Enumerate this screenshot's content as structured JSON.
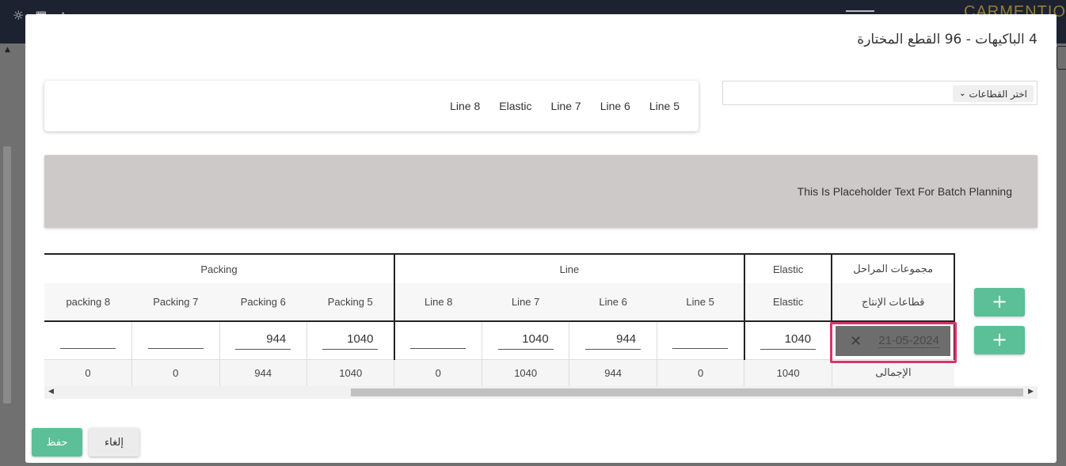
{
  "background": {
    "logo_text": "CARMENTIO"
  },
  "modal": {
    "title": "4 الباكيهات - 96 القطع المختارة",
    "sector_select": {
      "label": "اختر القطاعات"
    },
    "chips": [
      "Line 5",
      "Line 6",
      "Line 7",
      "Elastic",
      "Line 8"
    ],
    "banner_text": "This Is Placeholder Text For Batch Planning",
    "grid": {
      "row_header_group": "مجموعات المراحل",
      "row_header_stage": "قطاعات الإنتاج",
      "total_label": "الإجمالى",
      "groups": [
        {
          "name": "Elastic",
          "stages": [
            "Elastic"
          ]
        },
        {
          "name": "Line",
          "stages": [
            "Line 5",
            "Line 6",
            "Line 7",
            "Line 8"
          ]
        },
        {
          "name": "Packing",
          "stages": [
            "Packing 5",
            "Packing 6",
            "Packing 7",
            "packing 8"
          ]
        }
      ],
      "input_row": {
        "date": "21-05-2024",
        "values": [
          "1040",
          "",
          "944",
          "1040",
          "",
          "1040",
          "944",
          "",
          ""
        ]
      },
      "totals": [
        "1040",
        "0",
        "944",
        "1040",
        "0",
        "1040",
        "944",
        "0",
        "0"
      ]
    },
    "buttons": {
      "add": "+",
      "save": "حفظ",
      "cancel": "إلغاء"
    }
  }
}
